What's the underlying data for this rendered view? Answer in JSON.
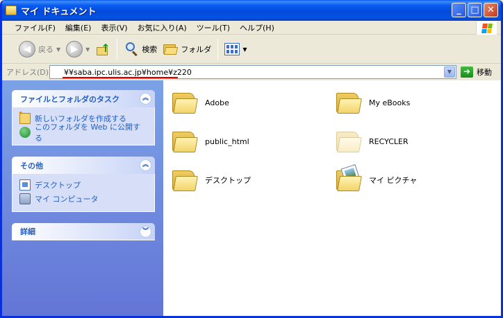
{
  "window": {
    "title": "マイ ドキュメント",
    "buttons": {
      "minimize": "_",
      "maximize": "□",
      "close": "✕"
    }
  },
  "menubar": {
    "items": [
      "ファイル(F)",
      "編集(E)",
      "表示(V)",
      "お気に入り(A)",
      "ツール(T)",
      "ヘルプ(H)"
    ]
  },
  "toolbar": {
    "back_label": "戻る",
    "search_label": "検索",
    "folders_label": "フォルダ"
  },
  "address": {
    "label": "アドレス(D)",
    "value": "¥¥saba.ipc.ulis.ac.jp¥home¥z220",
    "go_label": "移動"
  },
  "taskpane": {
    "panels": [
      {
        "title": "ファイルとフォルダのタスク",
        "items": [
          "新しいフォルダを作成する",
          "このフォルダを Web に公開する"
        ]
      },
      {
        "title": "その他",
        "items": [
          "デスクトップ",
          "マイ コンピュータ"
        ]
      },
      {
        "title": "詳細",
        "items": []
      }
    ]
  },
  "files": [
    {
      "name": "Adobe",
      "icon": "folder-icon"
    },
    {
      "name": "My eBooks",
      "icon": "folder-icon"
    },
    {
      "name": "public_html",
      "icon": "folder-icon"
    },
    {
      "name": "RECYCLER",
      "icon": "hidden-folder-icon"
    },
    {
      "name": "デスクトップ",
      "icon": "folder-icon"
    },
    {
      "name": "マイ ピクチャ",
      "icon": "pictures-folder-icon"
    }
  ],
  "colors": {
    "titlebar": "#0a5ef2",
    "taskpane_link": "#215dc6",
    "address_underline": "#e00000"
  }
}
